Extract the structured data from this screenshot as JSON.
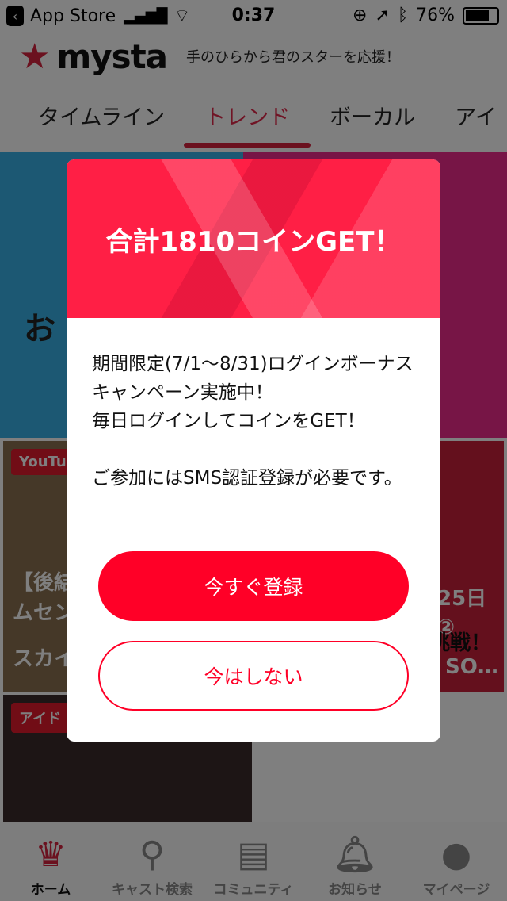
{
  "status_bar": {
    "back_label": "App Store",
    "time": "0:37",
    "battery": "76%",
    "battery_level": 0.76
  },
  "header": {
    "logo": "mysta",
    "tagline": "手のひらから君のスターを応援！"
  },
  "tabs": [
    {
      "label": "タイムライン"
    },
    {
      "label": "トレンド",
      "active": true
    },
    {
      "label": "ボーカル"
    },
    {
      "label": "アイ"
    }
  ],
  "banner": {
    "text": "お"
  },
  "cards": [
    {
      "tag": "YouTu",
      "title_lines": [
        "【後結",
        "ムセン",
        "スカイ"
      ]
    },
    {
      "title_lines": [
        "25日",
        "②",
        "挑戦！",
        "SO…"
      ]
    },
    {
      "tag": "アイド"
    }
  ],
  "modal": {
    "title": "合計1810コインGET！",
    "body": [
      "期間限定(7/1〜8/31)ログインボーナスキャンペーン実施中！\n毎日ログインしてコインをGET！",
      "ご参加にはSMS認証登録が必要です。"
    ],
    "primary_button": "今すぐ登録",
    "secondary_button": "今はしない",
    "accent_color": "#ff0027"
  },
  "tabbar": [
    {
      "label": "ホーム",
      "icon": "crown-icon",
      "active": true
    },
    {
      "label": "キャスト検索",
      "icon": "search-icon"
    },
    {
      "label": "コミュニティ",
      "icon": "chat-icon"
    },
    {
      "label": "お知らせ",
      "icon": "bell-icon"
    },
    {
      "label": "マイページ",
      "icon": "person-icon"
    }
  ]
}
